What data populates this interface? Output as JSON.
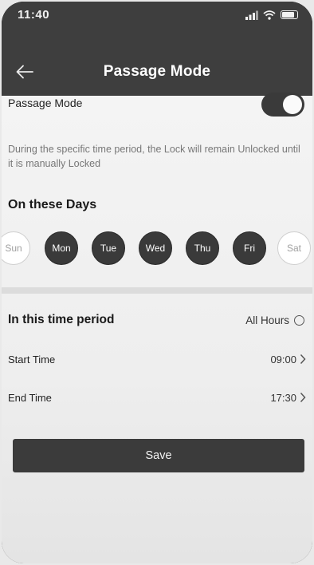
{
  "status_bar": {
    "time": "11:40",
    "icons": [
      "signal-icon",
      "wifi-icon",
      "battery-icon"
    ]
  },
  "nav": {
    "back_icon": "back-arrow-icon",
    "title": "Passage Mode"
  },
  "passage": {
    "label": "Passage Mode",
    "toggle_on": true,
    "description": "During the specific time period, the Lock will remain Unlocked until it is manually Locked"
  },
  "days": {
    "title": "On these Days",
    "items": [
      {
        "label": "Sun",
        "selected": false
      },
      {
        "label": "Mon",
        "selected": true
      },
      {
        "label": "Tue",
        "selected": true
      },
      {
        "label": "Wed",
        "selected": true
      },
      {
        "label": "Thu",
        "selected": true
      },
      {
        "label": "Fri",
        "selected": true
      },
      {
        "label": "Sat",
        "selected": false
      }
    ]
  },
  "period": {
    "title": "In this time period",
    "all_hours_label": "All Hours",
    "all_hours_selected": false,
    "start_label": "Start Time",
    "start_value": "09:00",
    "end_label": "End Time",
    "end_value": "17:30"
  },
  "save_label": "Save",
  "colors": {
    "header": "#3e3e3e",
    "accent": "#3a3a3a",
    "background": "#f2f2f2"
  }
}
